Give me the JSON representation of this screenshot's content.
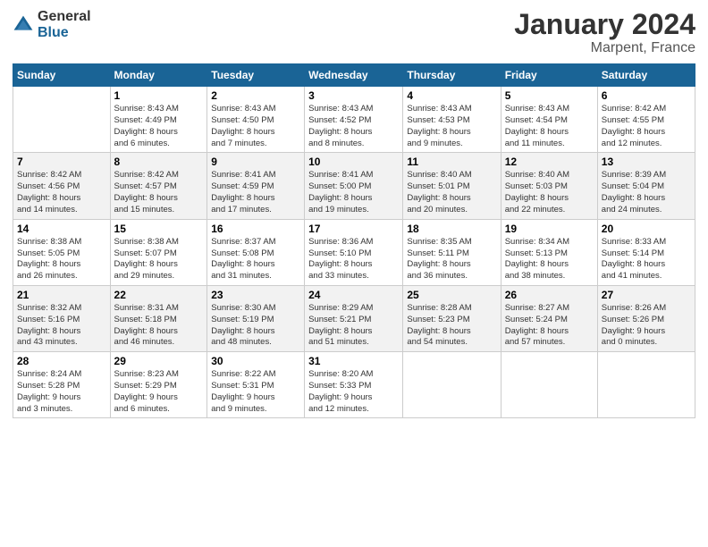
{
  "header": {
    "logo_general": "General",
    "logo_blue": "Blue",
    "title": "January 2024",
    "subtitle": "Marpent, France"
  },
  "columns": [
    "Sunday",
    "Monday",
    "Tuesday",
    "Wednesday",
    "Thursday",
    "Friday",
    "Saturday"
  ],
  "weeks": [
    [
      {
        "num": "",
        "info": ""
      },
      {
        "num": "1",
        "info": "Sunrise: 8:43 AM\nSunset: 4:49 PM\nDaylight: 8 hours\nand 6 minutes."
      },
      {
        "num": "2",
        "info": "Sunrise: 8:43 AM\nSunset: 4:50 PM\nDaylight: 8 hours\nand 7 minutes."
      },
      {
        "num": "3",
        "info": "Sunrise: 8:43 AM\nSunset: 4:52 PM\nDaylight: 8 hours\nand 8 minutes."
      },
      {
        "num": "4",
        "info": "Sunrise: 8:43 AM\nSunset: 4:53 PM\nDaylight: 8 hours\nand 9 minutes."
      },
      {
        "num": "5",
        "info": "Sunrise: 8:43 AM\nSunset: 4:54 PM\nDaylight: 8 hours\nand 11 minutes."
      },
      {
        "num": "6",
        "info": "Sunrise: 8:42 AM\nSunset: 4:55 PM\nDaylight: 8 hours\nand 12 minutes."
      }
    ],
    [
      {
        "num": "7",
        "info": "Sunrise: 8:42 AM\nSunset: 4:56 PM\nDaylight: 8 hours\nand 14 minutes."
      },
      {
        "num": "8",
        "info": "Sunrise: 8:42 AM\nSunset: 4:57 PM\nDaylight: 8 hours\nand 15 minutes."
      },
      {
        "num": "9",
        "info": "Sunrise: 8:41 AM\nSunset: 4:59 PM\nDaylight: 8 hours\nand 17 minutes."
      },
      {
        "num": "10",
        "info": "Sunrise: 8:41 AM\nSunset: 5:00 PM\nDaylight: 8 hours\nand 19 minutes."
      },
      {
        "num": "11",
        "info": "Sunrise: 8:40 AM\nSunset: 5:01 PM\nDaylight: 8 hours\nand 20 minutes."
      },
      {
        "num": "12",
        "info": "Sunrise: 8:40 AM\nSunset: 5:03 PM\nDaylight: 8 hours\nand 22 minutes."
      },
      {
        "num": "13",
        "info": "Sunrise: 8:39 AM\nSunset: 5:04 PM\nDaylight: 8 hours\nand 24 minutes."
      }
    ],
    [
      {
        "num": "14",
        "info": "Sunrise: 8:38 AM\nSunset: 5:05 PM\nDaylight: 8 hours\nand 26 minutes."
      },
      {
        "num": "15",
        "info": "Sunrise: 8:38 AM\nSunset: 5:07 PM\nDaylight: 8 hours\nand 29 minutes."
      },
      {
        "num": "16",
        "info": "Sunrise: 8:37 AM\nSunset: 5:08 PM\nDaylight: 8 hours\nand 31 minutes."
      },
      {
        "num": "17",
        "info": "Sunrise: 8:36 AM\nSunset: 5:10 PM\nDaylight: 8 hours\nand 33 minutes."
      },
      {
        "num": "18",
        "info": "Sunrise: 8:35 AM\nSunset: 5:11 PM\nDaylight: 8 hours\nand 36 minutes."
      },
      {
        "num": "19",
        "info": "Sunrise: 8:34 AM\nSunset: 5:13 PM\nDaylight: 8 hours\nand 38 minutes."
      },
      {
        "num": "20",
        "info": "Sunrise: 8:33 AM\nSunset: 5:14 PM\nDaylight: 8 hours\nand 41 minutes."
      }
    ],
    [
      {
        "num": "21",
        "info": "Sunrise: 8:32 AM\nSunset: 5:16 PM\nDaylight: 8 hours\nand 43 minutes."
      },
      {
        "num": "22",
        "info": "Sunrise: 8:31 AM\nSunset: 5:18 PM\nDaylight: 8 hours\nand 46 minutes."
      },
      {
        "num": "23",
        "info": "Sunrise: 8:30 AM\nSunset: 5:19 PM\nDaylight: 8 hours\nand 48 minutes."
      },
      {
        "num": "24",
        "info": "Sunrise: 8:29 AM\nSunset: 5:21 PM\nDaylight: 8 hours\nand 51 minutes."
      },
      {
        "num": "25",
        "info": "Sunrise: 8:28 AM\nSunset: 5:23 PM\nDaylight: 8 hours\nand 54 minutes."
      },
      {
        "num": "26",
        "info": "Sunrise: 8:27 AM\nSunset: 5:24 PM\nDaylight: 8 hours\nand 57 minutes."
      },
      {
        "num": "27",
        "info": "Sunrise: 8:26 AM\nSunset: 5:26 PM\nDaylight: 9 hours\nand 0 minutes."
      }
    ],
    [
      {
        "num": "28",
        "info": "Sunrise: 8:24 AM\nSunset: 5:28 PM\nDaylight: 9 hours\nand 3 minutes."
      },
      {
        "num": "29",
        "info": "Sunrise: 8:23 AM\nSunset: 5:29 PM\nDaylight: 9 hours\nand 6 minutes."
      },
      {
        "num": "30",
        "info": "Sunrise: 8:22 AM\nSunset: 5:31 PM\nDaylight: 9 hours\nand 9 minutes."
      },
      {
        "num": "31",
        "info": "Sunrise: 8:20 AM\nSunset: 5:33 PM\nDaylight: 9 hours\nand 12 minutes."
      },
      {
        "num": "",
        "info": ""
      },
      {
        "num": "",
        "info": ""
      },
      {
        "num": "",
        "info": ""
      }
    ]
  ]
}
